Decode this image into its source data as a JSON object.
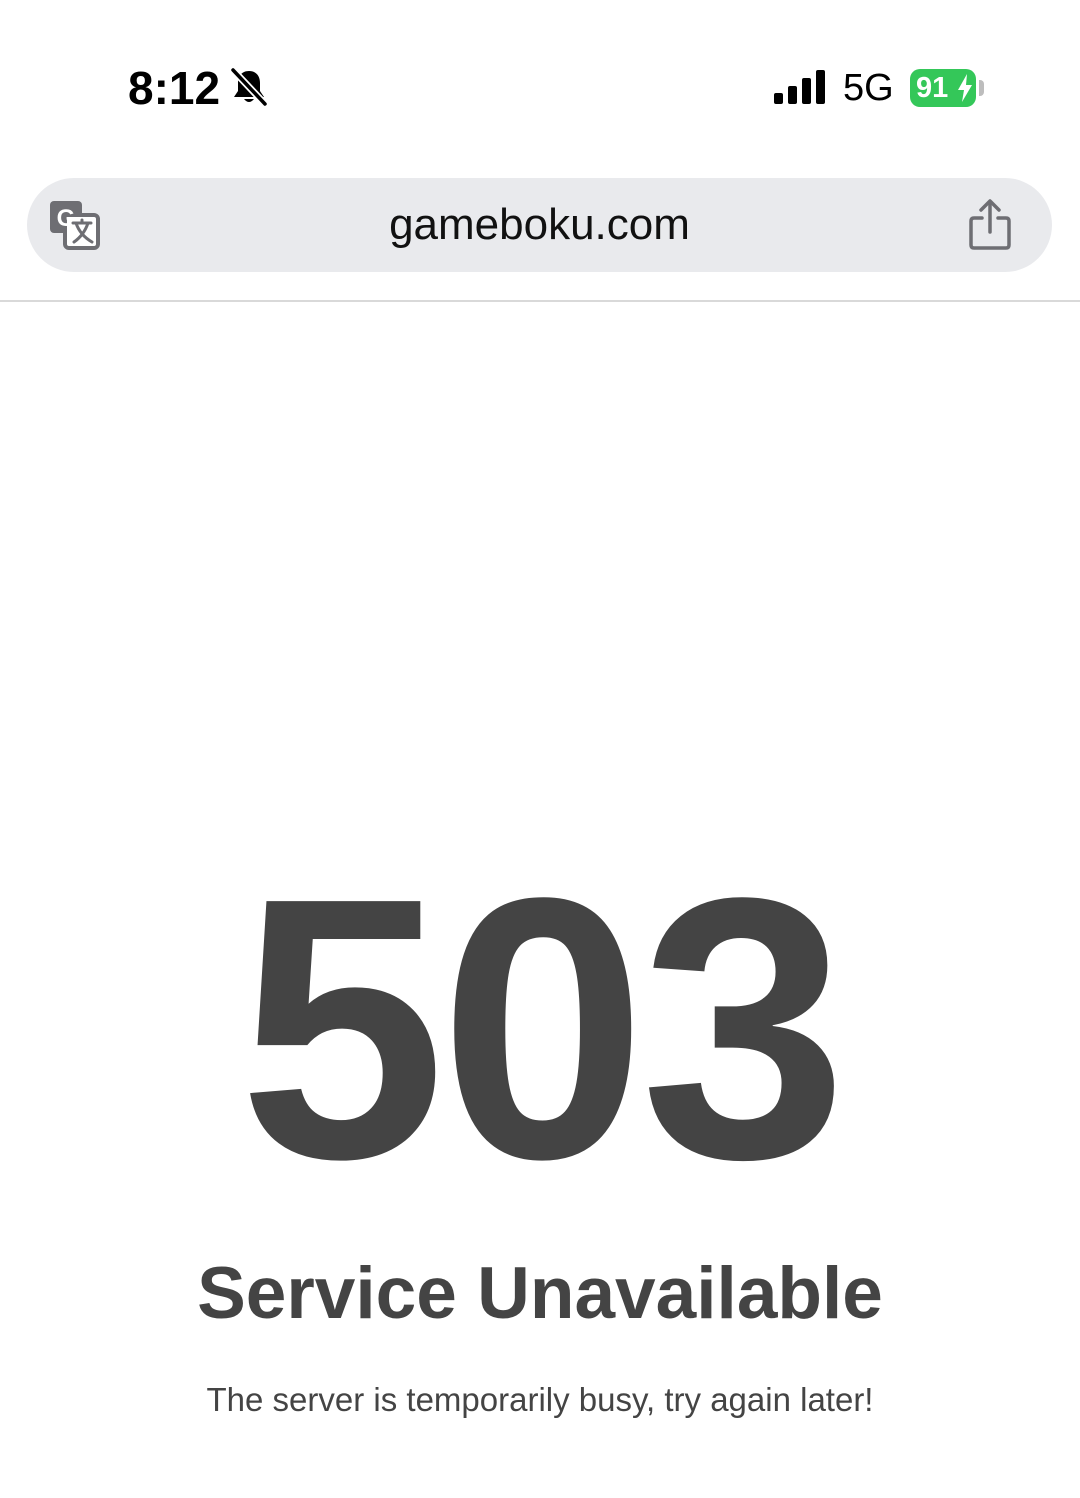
{
  "status_bar": {
    "time": "8:12",
    "network": "5G",
    "battery_percent": "91",
    "battery_level": 0.91,
    "signal_bars": 4,
    "icons": {
      "bell": "bell-slash-icon",
      "signal": "signal-bars-icon",
      "charging": "bolt-icon"
    },
    "colors": {
      "battery": "#34c759"
    }
  },
  "browser": {
    "url": "gameboku.com",
    "icons": {
      "translate": "translate-icon",
      "share": "share-icon"
    }
  },
  "page": {
    "error_code": "503",
    "title": "Service Unavailable",
    "message": "The server is temporarily busy, try again later!",
    "text_color": "#444444"
  }
}
